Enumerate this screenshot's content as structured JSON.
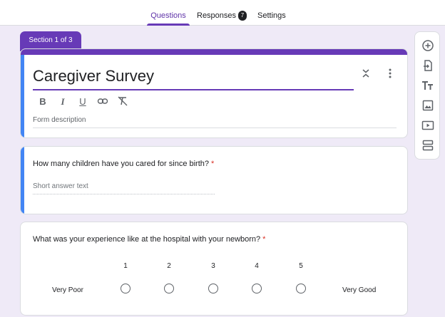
{
  "tabs": {
    "questions": "Questions",
    "responses": "Responses",
    "responses_count": "7",
    "settings": "Settings"
  },
  "section": {
    "label": "Section 1 of 3"
  },
  "form": {
    "title": "Caregiver Survey",
    "description_placeholder": "Form description"
  },
  "questions": [
    {
      "text": "How many children have you cared for since birth?",
      "required_mark": "*",
      "answer_placeholder": "Short answer text"
    },
    {
      "text": "What was your experience like at the hospital with your newborn?",
      "required_mark": "*",
      "scale": [
        "1",
        "2",
        "3",
        "4",
        "5"
      ],
      "low_label": "Very Poor",
      "high_label": "Very Good"
    }
  ],
  "toolbar_icons": [
    "add-question-icon",
    "import-questions-icon",
    "add-title-icon",
    "add-image-icon",
    "add-video-icon",
    "add-section-icon"
  ],
  "colors": {
    "accent": "#673ab7",
    "focus": "#4285f4",
    "required": "#d93025",
    "background": "#efeaf7"
  }
}
